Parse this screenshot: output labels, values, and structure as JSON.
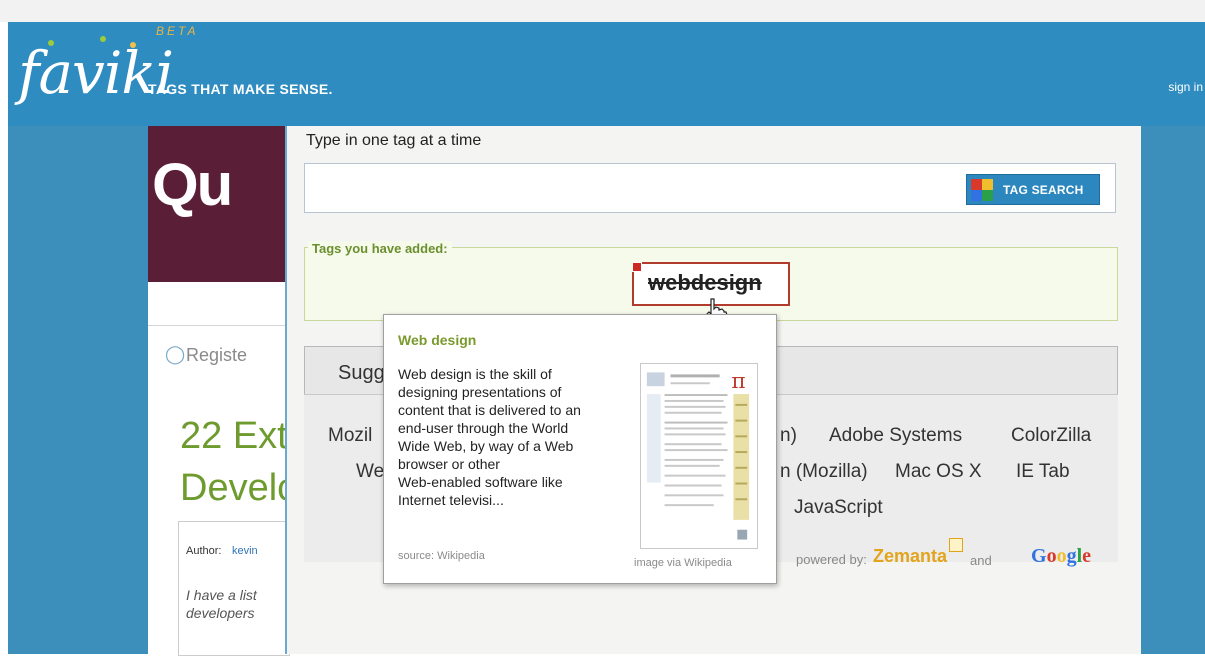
{
  "header": {
    "logo": "faviki",
    "beta": "BETA",
    "slogan": "TAGS THAT MAKE SENSE.",
    "signin": "sign in"
  },
  "background_page": {
    "site_logo_text": "Qu",
    "register": "Registe",
    "title_line1": "22 Ext",
    "title_line2": "Develc",
    "author_label": "Author:",
    "author_name": "kevin",
    "excerpt_line1": "I have a list",
    "excerpt_line2": "developers"
  },
  "tagger": {
    "prompt": "Type in one tag at a time",
    "input_value": "",
    "search_button": "TAG SEARCH",
    "added_legend": "Tags you have added:",
    "added_tags": [
      "webdesign"
    ],
    "suggestions_heading": "Sugg",
    "suggestions": [
      "Mozil",
      "n)",
      "Adobe Systems",
      "ColorZilla",
      "We",
      "n (Mozilla)",
      "Mac OS X",
      "IE Tab",
      "JavaScript"
    ],
    "powered_by": "powered by:",
    "zemanta": "Zemanta",
    "and": "and",
    "google": [
      "G",
      "o",
      "o",
      "g",
      "l",
      "e"
    ]
  },
  "popup": {
    "title": "Web design",
    "lines": [
      "Web design is the skill of",
      "designing presentations of",
      "content that is delivered to an",
      "end-user through the World",
      "Wide Web, by way of a Web",
      "browser or other",
      "Web-enabled software like",
      "Internet televisi..."
    ],
    "source": "source: Wikipedia",
    "image_caption": "image via Wikipedia"
  },
  "colors": {
    "header_blue": "#2e8cc0",
    "tag_green": "#6b8f2f",
    "chip_border": "#b23b2b",
    "zemanta_orange": "#e2a41c"
  }
}
